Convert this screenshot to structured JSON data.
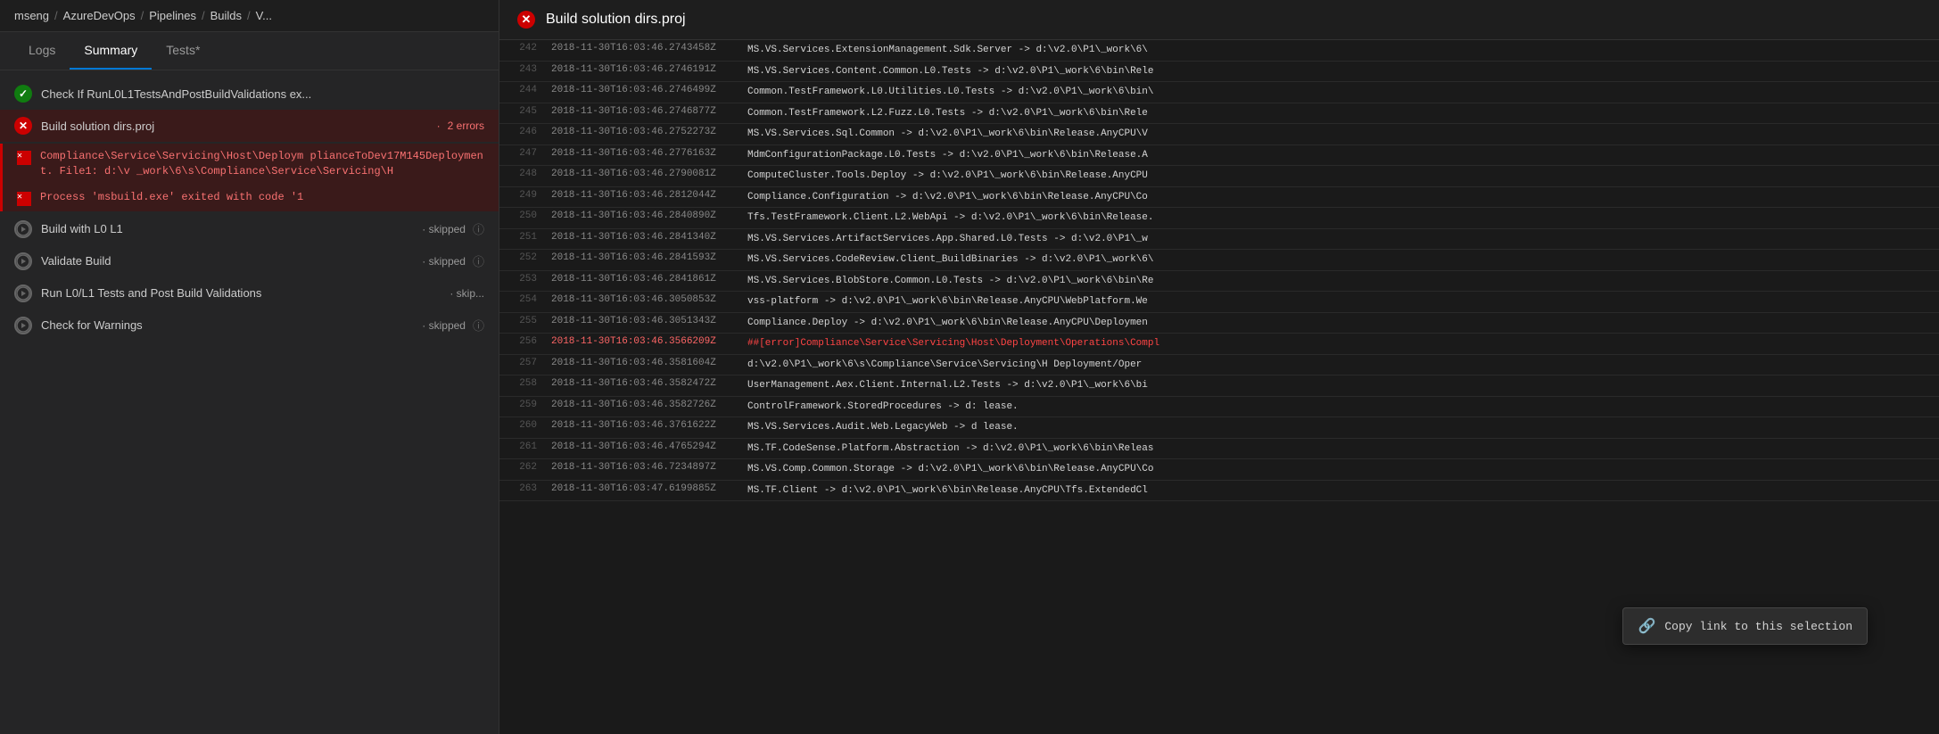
{
  "breadcrumb": {
    "items": [
      "mseng",
      "AzureDevOps",
      "Pipelines",
      "Builds",
      "V..."
    ]
  },
  "tabs": {
    "items": [
      {
        "label": "Logs",
        "active": false
      },
      {
        "label": "Summary",
        "active": true
      },
      {
        "label": "Tests*",
        "active": false
      }
    ]
  },
  "pipeline_steps": [
    {
      "id": "check-runtests",
      "icon": "check",
      "label": "Check If RunL0L1TestsAndPostBuildValidations ex...",
      "status": "",
      "errors": 0
    },
    {
      "id": "build-dirs",
      "icon": "error",
      "label": "Build solution dirs.proj",
      "status": "2 errors",
      "errors": 2
    }
  ],
  "error_items": [
    {
      "id": "error-compliance",
      "msg": "Compliance\\Service\\Servicing\\Host\\Deploym plianceToDev17M145Deployment. File1: d:\\v _work\\6\\s\\Compliance\\Service\\Servicing\\H"
    },
    {
      "id": "error-msbuild",
      "msg": "Process 'msbuild.exe' exited with code '1"
    }
  ],
  "skipped_steps": [
    {
      "id": "build-l0l1",
      "label": "Build with L0 L1",
      "status": "skipped"
    },
    {
      "id": "validate-build",
      "label": "Validate Build",
      "status": "skipped"
    },
    {
      "id": "run-tests",
      "label": "Run L0/L1 Tests and Post Build Validations",
      "status": "skip..."
    },
    {
      "id": "check-warnings",
      "label": "Check for Warnings",
      "status": "skipped"
    }
  ],
  "right_panel": {
    "title": "Build solution dirs.proj",
    "icon": "error"
  },
  "log_entries": [
    {
      "line": 242,
      "timestamp": "2018-11-30T16:03:46.2743458Z",
      "message": "MS.VS.Services.ExtensionManagement.Sdk.Server -> d:\\v2.0\\P1\\_work\\6\\"
    },
    {
      "line": 243,
      "timestamp": "2018-11-30T16:03:46.2746191Z",
      "message": "MS.VS.Services.Content.Common.L0.Tests -> d:\\v2.0\\P1\\_work\\6\\bin\\Rele"
    },
    {
      "line": 244,
      "timestamp": "2018-11-30T16:03:46.2746499Z",
      "message": "Common.TestFramework.L0.Utilities.L0.Tests -> d:\\v2.0\\P1\\_work\\6\\bin\\"
    },
    {
      "line": 245,
      "timestamp": "2018-11-30T16:03:46.2746877Z",
      "message": "Common.TestFramework.L2.Fuzz.L0.Tests -> d:\\v2.0\\P1\\_work\\6\\bin\\Rele"
    },
    {
      "line": 246,
      "timestamp": "2018-11-30T16:03:46.2752273Z",
      "message": "MS.VS.Services.Sql.Common -> d:\\v2.0\\P1\\_work\\6\\bin\\Release.AnyCPU\\V"
    },
    {
      "line": 247,
      "timestamp": "2018-11-30T16:03:46.2776163Z",
      "message": "MdmConfigurationPackage.L0.Tests -> d:\\v2.0\\P1\\_work\\6\\bin\\Release.A"
    },
    {
      "line": 248,
      "timestamp": "2018-11-30T16:03:46.2790081Z",
      "message": "ComputeCluster.Tools.Deploy -> d:\\v2.0\\P1\\_work\\6\\bin\\Release.AnyCPU"
    },
    {
      "line": 249,
      "timestamp": "2018-11-30T16:03:46.2812044Z",
      "message": "Compliance.Configuration -> d:\\v2.0\\P1\\_work\\6\\bin\\Release.AnyCPU\\Co"
    },
    {
      "line": 250,
      "timestamp": "2018-11-30T16:03:46.2840890Z",
      "message": "Tfs.TestFramework.Client.L2.WebApi -> d:\\v2.0\\P1\\_work\\6\\bin\\Release."
    },
    {
      "line": 251,
      "timestamp": "2018-11-30T16:03:46.2841340Z",
      "message": "MS.VS.Services.ArtifactServices.App.Shared.L0.Tests -> d:\\v2.0\\P1\\_w"
    },
    {
      "line": 252,
      "timestamp": "2018-11-30T16:03:46.2841593Z",
      "message": "MS.VS.Services.CodeReview.Client_BuildBinaries -> d:\\v2.0\\P1\\_work\\6\\"
    },
    {
      "line": 253,
      "timestamp": "2018-11-30T16:03:46.2841861Z",
      "message": "MS.VS.Services.BlobStore.Common.L0.Tests -> d:\\v2.0\\P1\\_work\\6\\bin\\Re"
    },
    {
      "line": 254,
      "timestamp": "2018-11-30T16:03:46.3050853Z",
      "message": "vss-platform -> d:\\v2.0\\P1\\_work\\6\\bin\\Release.AnyCPU\\WebPlatform.We"
    },
    {
      "line": 255,
      "timestamp": "2018-11-30T16:03:46.3051343Z",
      "message": "Compliance.Deploy -> d:\\v2.0\\P1\\_work\\6\\bin\\Release.AnyCPU\\Deploymen"
    },
    {
      "line": 256,
      "timestamp": "2018-11-30T16:03:46.3566209Z",
      "message": "##[error]Compliance\\Service\\Servicing\\Host\\Deployment\\Operations\\Compl",
      "is_error": true
    },
    {
      "line": 257,
      "timestamp": "2018-11-30T16:03:46.3581604Z",
      "message": "d:\\v2.0\\P1\\_work\\6\\s\\Compliance\\Service\\Servicing\\H      Deployment/Oper"
    },
    {
      "line": 258,
      "timestamp": "2018-11-30T16:03:46.3582472Z",
      "message": "UserManagement.Aex.Client.Internal.L2.Tests -> d:\\v2.0\\P1\\_work\\6\\bi"
    },
    {
      "line": 259,
      "timestamp": "2018-11-30T16:03:46.3582726Z",
      "message": "ControlFramework.StoredProcedures -> d:                       lease."
    },
    {
      "line": 260,
      "timestamp": "2018-11-30T16:03:46.3761622Z",
      "message": "MS.VS.Services.Audit.Web.LegacyWeb -> d                       lease."
    },
    {
      "line": 261,
      "timestamp": "2018-11-30T16:03:46.4765294Z",
      "message": "MS.TF.CodeSense.Platform.Abstraction -> d:\\v2.0\\P1\\_work\\6\\bin\\Releas"
    },
    {
      "line": 262,
      "timestamp": "2018-11-30T16:03:46.7234897Z",
      "message": "MS.VS.Comp.Common.Storage -> d:\\v2.0\\P1\\_work\\6\\bin\\Release.AnyCPU\\Co"
    },
    {
      "line": 263,
      "timestamp": "2018-11-30T16:03:47.6199885Z",
      "message": "MS.TF.Client -> d:\\v2.0\\P1\\_work\\6\\bin\\Release.AnyCPU\\Tfs.ExtendedCl"
    }
  ],
  "copy_link_popup": {
    "label": "Copy link to this selection",
    "link_icon": "🔗"
  },
  "colors": {
    "error_red": "#c00000",
    "accent_blue": "#0078d4",
    "log_error": "#ff4444",
    "log_error_timestamp": "#ff6666"
  }
}
